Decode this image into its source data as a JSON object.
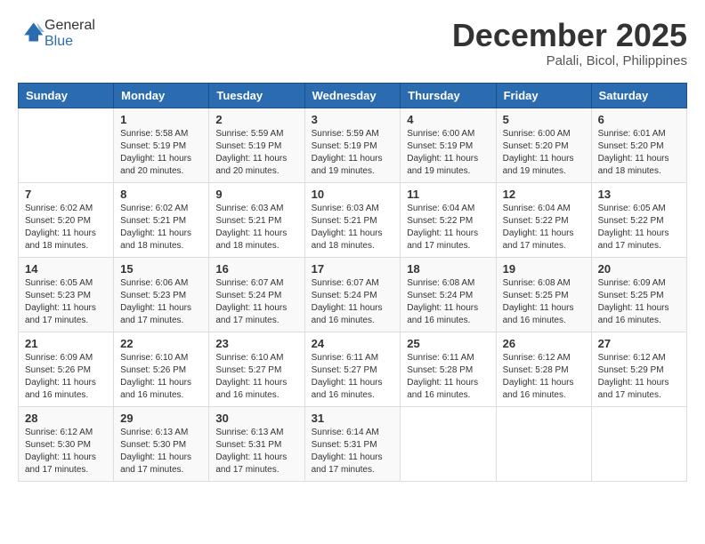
{
  "logo": {
    "general": "General",
    "blue": "Blue"
  },
  "title": "December 2025",
  "location": "Palali, Bicol, Philippines",
  "days_of_week": [
    "Sunday",
    "Monday",
    "Tuesday",
    "Wednesday",
    "Thursday",
    "Friday",
    "Saturday"
  ],
  "weeks": [
    [
      {
        "day": "",
        "sunrise": "",
        "sunset": "",
        "daylight": ""
      },
      {
        "day": "1",
        "sunrise": "Sunrise: 5:58 AM",
        "sunset": "Sunset: 5:19 PM",
        "daylight": "Daylight: 11 hours and 20 minutes."
      },
      {
        "day": "2",
        "sunrise": "Sunrise: 5:59 AM",
        "sunset": "Sunset: 5:19 PM",
        "daylight": "Daylight: 11 hours and 20 minutes."
      },
      {
        "day": "3",
        "sunrise": "Sunrise: 5:59 AM",
        "sunset": "Sunset: 5:19 PM",
        "daylight": "Daylight: 11 hours and 19 minutes."
      },
      {
        "day": "4",
        "sunrise": "Sunrise: 6:00 AM",
        "sunset": "Sunset: 5:19 PM",
        "daylight": "Daylight: 11 hours and 19 minutes."
      },
      {
        "day": "5",
        "sunrise": "Sunrise: 6:00 AM",
        "sunset": "Sunset: 5:20 PM",
        "daylight": "Daylight: 11 hours and 19 minutes."
      },
      {
        "day": "6",
        "sunrise": "Sunrise: 6:01 AM",
        "sunset": "Sunset: 5:20 PM",
        "daylight": "Daylight: 11 hours and 18 minutes."
      }
    ],
    [
      {
        "day": "7",
        "sunrise": "Sunrise: 6:02 AM",
        "sunset": "Sunset: 5:20 PM",
        "daylight": "Daylight: 11 hours and 18 minutes."
      },
      {
        "day": "8",
        "sunrise": "Sunrise: 6:02 AM",
        "sunset": "Sunset: 5:21 PM",
        "daylight": "Daylight: 11 hours and 18 minutes."
      },
      {
        "day": "9",
        "sunrise": "Sunrise: 6:03 AM",
        "sunset": "Sunset: 5:21 PM",
        "daylight": "Daylight: 11 hours and 18 minutes."
      },
      {
        "day": "10",
        "sunrise": "Sunrise: 6:03 AM",
        "sunset": "Sunset: 5:21 PM",
        "daylight": "Daylight: 11 hours and 18 minutes."
      },
      {
        "day": "11",
        "sunrise": "Sunrise: 6:04 AM",
        "sunset": "Sunset: 5:22 PM",
        "daylight": "Daylight: 11 hours and 17 minutes."
      },
      {
        "day": "12",
        "sunrise": "Sunrise: 6:04 AM",
        "sunset": "Sunset: 5:22 PM",
        "daylight": "Daylight: 11 hours and 17 minutes."
      },
      {
        "day": "13",
        "sunrise": "Sunrise: 6:05 AM",
        "sunset": "Sunset: 5:22 PM",
        "daylight": "Daylight: 11 hours and 17 minutes."
      }
    ],
    [
      {
        "day": "14",
        "sunrise": "Sunrise: 6:05 AM",
        "sunset": "Sunset: 5:23 PM",
        "daylight": "Daylight: 11 hours and 17 minutes."
      },
      {
        "day": "15",
        "sunrise": "Sunrise: 6:06 AM",
        "sunset": "Sunset: 5:23 PM",
        "daylight": "Daylight: 11 hours and 17 minutes."
      },
      {
        "day": "16",
        "sunrise": "Sunrise: 6:07 AM",
        "sunset": "Sunset: 5:24 PM",
        "daylight": "Daylight: 11 hours and 17 minutes."
      },
      {
        "day": "17",
        "sunrise": "Sunrise: 6:07 AM",
        "sunset": "Sunset: 5:24 PM",
        "daylight": "Daylight: 11 hours and 16 minutes."
      },
      {
        "day": "18",
        "sunrise": "Sunrise: 6:08 AM",
        "sunset": "Sunset: 5:24 PM",
        "daylight": "Daylight: 11 hours and 16 minutes."
      },
      {
        "day": "19",
        "sunrise": "Sunrise: 6:08 AM",
        "sunset": "Sunset: 5:25 PM",
        "daylight": "Daylight: 11 hours and 16 minutes."
      },
      {
        "day": "20",
        "sunrise": "Sunrise: 6:09 AM",
        "sunset": "Sunset: 5:25 PM",
        "daylight": "Daylight: 11 hours and 16 minutes."
      }
    ],
    [
      {
        "day": "21",
        "sunrise": "Sunrise: 6:09 AM",
        "sunset": "Sunset: 5:26 PM",
        "daylight": "Daylight: 11 hours and 16 minutes."
      },
      {
        "day": "22",
        "sunrise": "Sunrise: 6:10 AM",
        "sunset": "Sunset: 5:26 PM",
        "daylight": "Daylight: 11 hours and 16 minutes."
      },
      {
        "day": "23",
        "sunrise": "Sunrise: 6:10 AM",
        "sunset": "Sunset: 5:27 PM",
        "daylight": "Daylight: 11 hours and 16 minutes."
      },
      {
        "day": "24",
        "sunrise": "Sunrise: 6:11 AM",
        "sunset": "Sunset: 5:27 PM",
        "daylight": "Daylight: 11 hours and 16 minutes."
      },
      {
        "day": "25",
        "sunrise": "Sunrise: 6:11 AM",
        "sunset": "Sunset: 5:28 PM",
        "daylight": "Daylight: 11 hours and 16 minutes."
      },
      {
        "day": "26",
        "sunrise": "Sunrise: 6:12 AM",
        "sunset": "Sunset: 5:28 PM",
        "daylight": "Daylight: 11 hours and 16 minutes."
      },
      {
        "day": "27",
        "sunrise": "Sunrise: 6:12 AM",
        "sunset": "Sunset: 5:29 PM",
        "daylight": "Daylight: 11 hours and 17 minutes."
      }
    ],
    [
      {
        "day": "28",
        "sunrise": "Sunrise: 6:12 AM",
        "sunset": "Sunset: 5:30 PM",
        "daylight": "Daylight: 11 hours and 17 minutes."
      },
      {
        "day": "29",
        "sunrise": "Sunrise: 6:13 AM",
        "sunset": "Sunset: 5:30 PM",
        "daylight": "Daylight: 11 hours and 17 minutes."
      },
      {
        "day": "30",
        "sunrise": "Sunrise: 6:13 AM",
        "sunset": "Sunset: 5:31 PM",
        "daylight": "Daylight: 11 hours and 17 minutes."
      },
      {
        "day": "31",
        "sunrise": "Sunrise: 6:14 AM",
        "sunset": "Sunset: 5:31 PM",
        "daylight": "Daylight: 11 hours and 17 minutes."
      },
      {
        "day": "",
        "sunrise": "",
        "sunset": "",
        "daylight": ""
      },
      {
        "day": "",
        "sunrise": "",
        "sunset": "",
        "daylight": ""
      },
      {
        "day": "",
        "sunrise": "",
        "sunset": "",
        "daylight": ""
      }
    ]
  ]
}
